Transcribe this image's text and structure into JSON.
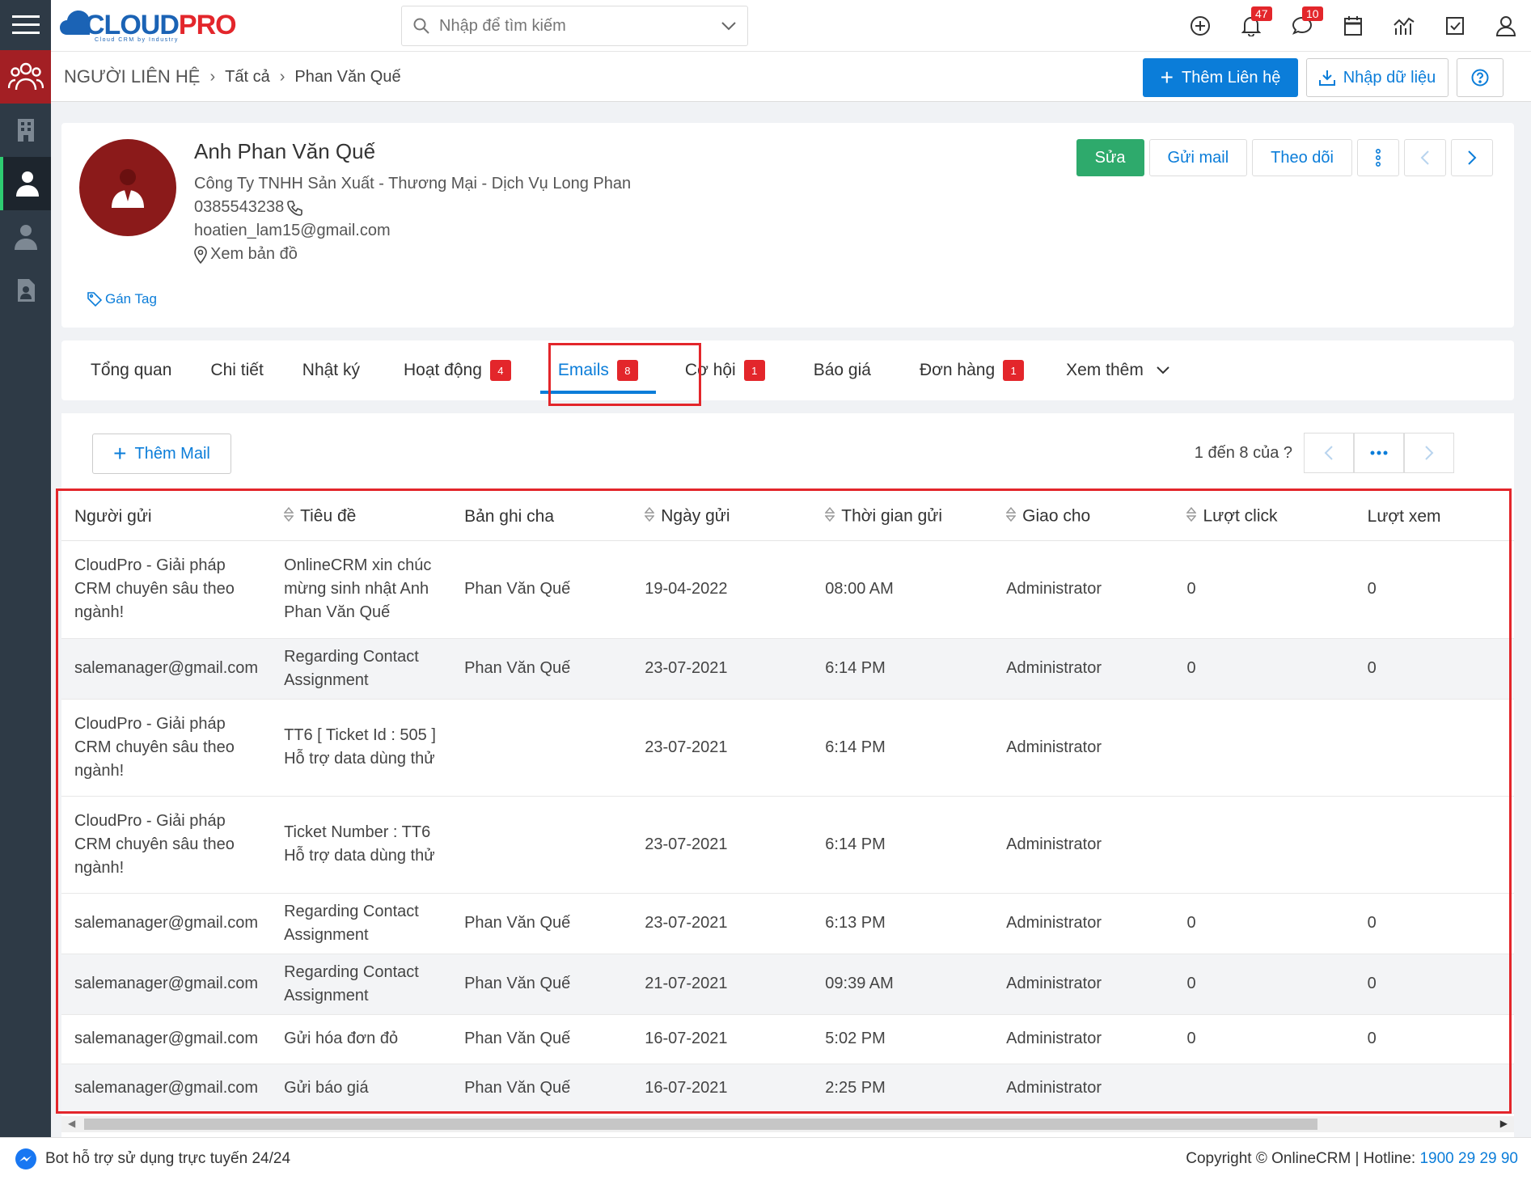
{
  "brand": {
    "name_a": "CLOUD",
    "name_b": "PRO",
    "tagline": "Cloud CRM by Industry"
  },
  "search": {
    "placeholder": "Nhập để tìm kiếm"
  },
  "top_icons": {
    "notifications_count": "47",
    "messages_count": "10"
  },
  "breadcrumb": {
    "module": "NGƯỜI LIÊN HỆ",
    "list": "Tất cả",
    "record": "Phan Văn Quế"
  },
  "header_actions": {
    "add_label": "Thêm Liên hệ",
    "import_label": "Nhập dữ liệu"
  },
  "contact": {
    "name": "Anh Phan Văn Quế",
    "company": "Công Ty TNHH Sản Xuất - Thương Mại - Dịch Vụ Long Phan",
    "phone": "0385543238",
    "email": "hoatien_lam15@gmail.com",
    "map_label": "Xem bản đồ",
    "tag_label": "Gán Tag"
  },
  "record_actions": {
    "edit": "Sửa",
    "send_mail": "Gửi mail",
    "follow": "Theo dõi"
  },
  "tabs": [
    {
      "label": "Tổng quan",
      "badge": ""
    },
    {
      "label": "Chi tiết",
      "badge": ""
    },
    {
      "label": "Nhật ký",
      "badge": ""
    },
    {
      "label": "Hoạt động",
      "badge": "4"
    },
    {
      "label": "Emails",
      "badge": "8"
    },
    {
      "label": "Cơ hội",
      "badge": "1"
    },
    {
      "label": "Báo giá",
      "badge": ""
    },
    {
      "label": "Đơn hàng",
      "badge": "1"
    },
    {
      "label": "Xem thêm",
      "badge": ""
    }
  ],
  "emails": {
    "add_label": "Thêm Mail",
    "pager_text": "1 đến 8 của",
    "pager_q": "?",
    "columns": [
      "Người gửi",
      "Tiêu đề",
      "Bản ghi cha",
      "Ngày gửi",
      "Thời gian gửi",
      "Giao cho",
      "Lượt click",
      "Lượt xem"
    ],
    "rows": [
      [
        "CloudPro - Giải pháp CRM chuyên sâu theo ngành!",
        "OnlineCRM xin chúc mừng sinh nhật Anh Phan Văn Quế",
        "Phan Văn Quế",
        "19-04-2022",
        "08:00 AM",
        "Administrator",
        "0",
        "0"
      ],
      [
        "salemanager@gmail.com",
        "Regarding Contact Assignment",
        "Phan Văn Quế",
        "23-07-2021",
        "6:14 PM",
        "Administrator",
        "0",
        "0"
      ],
      [
        "CloudPro - Giải pháp CRM chuyên sâu theo ngành!",
        "TT6 [ Ticket Id : 505 ] Hỗ trợ data dùng thử",
        "",
        "23-07-2021",
        "6:14 PM",
        "Administrator",
        "",
        ""
      ],
      [
        "CloudPro - Giải pháp CRM chuyên sâu theo ngành!",
        "Ticket Number : TT6 Hỗ trợ data dùng thử",
        "",
        "23-07-2021",
        "6:14 PM",
        "Administrator",
        "",
        ""
      ],
      [
        "salemanager@gmail.com",
        "Regarding Contact Assignment",
        "Phan Văn Quế",
        "23-07-2021",
        "6:13 PM",
        "Administrator",
        "0",
        "0"
      ],
      [
        "salemanager@gmail.com",
        "Regarding Contact Assignment",
        "Phan Văn Quế",
        "21-07-2021",
        "09:39 AM",
        "Administrator",
        "0",
        "0"
      ],
      [
        "salemanager@gmail.com",
        "Gửi hóa đơn đỏ",
        "Phan Văn Quế",
        "16-07-2021",
        "5:02 PM",
        "Administrator",
        "0",
        "0"
      ],
      [
        "salemanager@gmail.com",
        "Gửi báo giá",
        "Phan Văn Quế",
        "16-07-2021",
        "2:25 PM",
        "Administrator",
        "",
        ""
      ]
    ]
  },
  "footer": {
    "bot_text": "Bot hỗ trợ sử dụng trực tuyến 24/24",
    "copyright": "Copyright © OnlineCRM | Hotline:",
    "hotline": "1900 29 29 90"
  },
  "colors": {
    "primary": "#0b7dd9",
    "brand_red": "#e3262b",
    "success": "#2eaa6c",
    "sidebar": "#2e3a46"
  }
}
